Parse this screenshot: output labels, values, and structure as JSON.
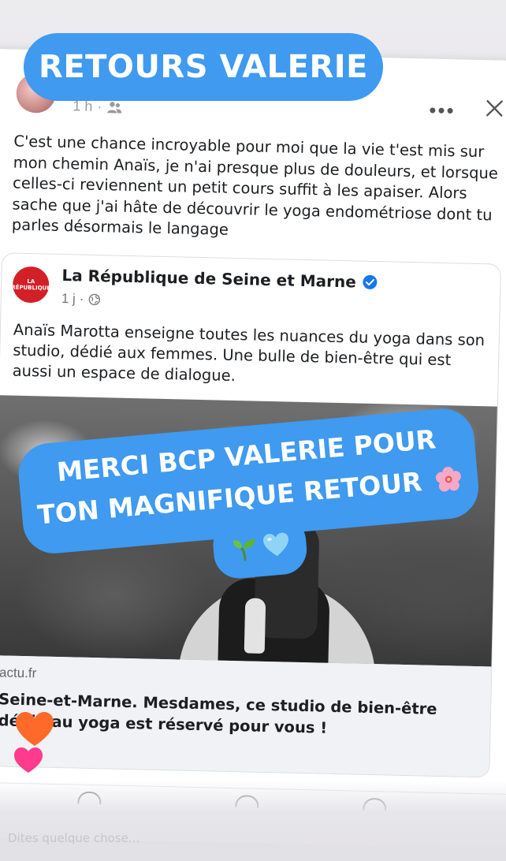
{
  "post": {
    "time": "1 h",
    "caption": "C'est une chance incroyable pour moi que la vie t'est mis sur mon chemin Anaïs, je n'ai presque plus de douleurs, et lorsque celles-ci reviennent un petit cours suffit à les apaiser. Alors sache que j'ai hâte de découvrir le yoga endométriose dont tu parles désormais le langage"
  },
  "shared": {
    "logo_text": "LA RÉPUBLIQUE",
    "page_name": "La République de Seine et Marne",
    "time": "1 j",
    "text": "Anaïs Marotta enseigne toutes les nuances du yoga dans son studio, dédié aux femmes. Une bulle de bien-être qui est aussi un espace de dialogue.",
    "link_domain": "actu.fr",
    "link_title": "Seine-et-Marne. Mesdames, ce studio de bien-être dédié au yoga est réservé pour vous !"
  },
  "stickers": {
    "title": "RETOURS VALERIE",
    "merci_line1": "MERCI BCP VALERIE POUR",
    "merci_line2": "TON MAGNIFIQUE RETOUR"
  },
  "comment_hint": "Dites quelque chose...",
  "colors": {
    "sticker_blue": "#3f9af0",
    "verified_blue": "#1877f2",
    "logo_red": "#d32027"
  },
  "icons": [
    "friends-icon",
    "more-icon",
    "close-icon",
    "verified-icon",
    "globe-icon",
    "flower-emoji",
    "sprout-emoji",
    "blue-heart-emoji",
    "orange-heart-icon",
    "pink-heart-icon"
  ]
}
